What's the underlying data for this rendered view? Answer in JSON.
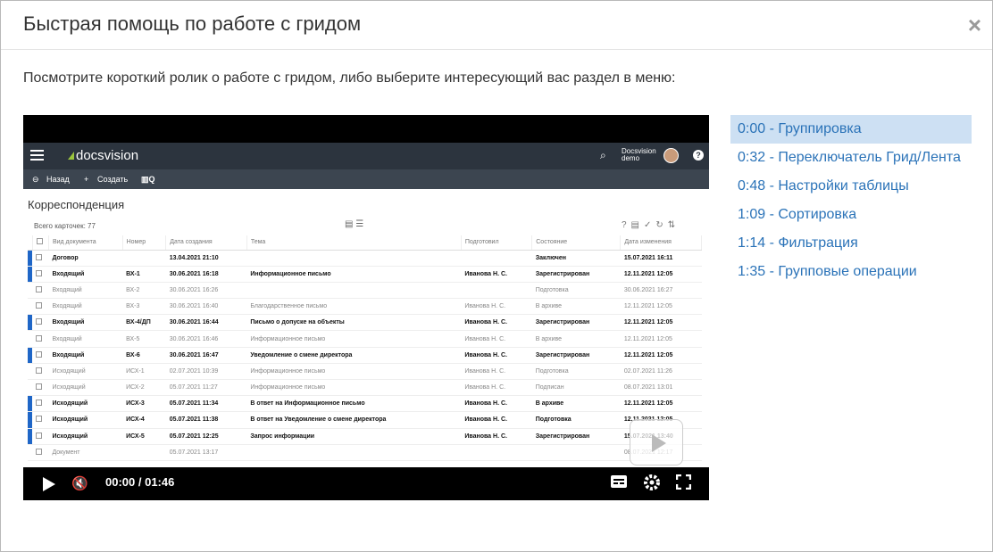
{
  "modal": {
    "title": "Быстрая помощь по работе с гридом",
    "close_label": "×",
    "intro": "Посмотрите короткий ролик о работе с гридом, либо выберите интересующий вас раздел в меню:"
  },
  "video": {
    "time": "00:00 / 01:46",
    "frame": {
      "brand": "docsvision",
      "user_line1": "Docsvision",
      "user_line2": "demo",
      "toolbar": {
        "back": "Назад",
        "create": "Создать"
      },
      "page_title": "Корреспонденция",
      "grid_info": "Всего карточек: 77",
      "columns": [
        "Вид документа",
        "Номер",
        "Дата создания",
        "Тема",
        "Подготовил",
        "Состояние",
        "Дата изменения"
      ],
      "rows": [
        [
          "Договор",
          "",
          "13.04.2021 21:10",
          "",
          "",
          "Заключен",
          "15.07.2021 16:11"
        ],
        [
          "Входящий",
          "ВХ-1",
          "30.06.2021 16:18",
          "Информационное письмо",
          "Иванова Н. С.",
          "Зарегистрирован",
          "12.11.2021 12:05"
        ],
        [
          "Входящий",
          "ВХ-2",
          "30.06.2021 16:26",
          "",
          "",
          "Подготовка",
          "30.06.2021 16:27"
        ],
        [
          "Входящий",
          "ВХ-3",
          "30.06.2021 16:40",
          "Благодарственное письмо",
          "Иванова Н. С.",
          "В архиве",
          "12.11.2021 12:05"
        ],
        [
          "Входящий",
          "ВХ-4/ДП",
          "30.06.2021 16:44",
          "Письмо о допуске на объекты",
          "Иванова Н. С.",
          "Зарегистрирован",
          "12.11.2021 12:05"
        ],
        [
          "Входящий",
          "ВХ-5",
          "30.06.2021 16:46",
          "Информационное письмо",
          "Иванова Н. С.",
          "В архиве",
          "12.11.2021 12:05"
        ],
        [
          "Входящий",
          "ВХ-6",
          "30.06.2021 16:47",
          "Уведомление о смене директора",
          "Иванова Н. С.",
          "Зарегистрирован",
          "12.11.2021 12:05"
        ],
        [
          "Исходящий",
          "ИСХ-1",
          "02.07.2021 10:39",
          "Информационное письмо",
          "Иванова Н. С.",
          "Подготовка",
          "02.07.2021 11:26"
        ],
        [
          "Исходящий",
          "ИСХ-2",
          "05.07.2021 11:27",
          "Информационное письмо",
          "Иванова Н. С.",
          "Подписан",
          "08.07.2021 13:01"
        ],
        [
          "Исходящий",
          "ИСХ-3",
          "05.07.2021 11:34",
          "В ответ на Информационное письмо",
          "Иванова Н. С.",
          "В архиве",
          "12.11.2021 12:05"
        ],
        [
          "Исходящий",
          "ИСХ-4",
          "05.07.2021 11:38",
          "В ответ на Уведомление о смене директора",
          "Иванова Н. С.",
          "Подготовка",
          "12.11.2021 12:05"
        ],
        [
          "Исходящий",
          "ИСХ-5",
          "05.07.2021 12:25",
          "Запрос информации",
          "Иванова Н. С.",
          "Зарегистрирован",
          "15.07.2021 13:40"
        ],
        [
          "Документ",
          "",
          "05.07.2021 13:17",
          "",
          "",
          "",
          "08.07.2021 12:17"
        ]
      ],
      "row_styles": [
        "unread",
        "unread",
        "read",
        "read",
        "unread",
        "read",
        "unread",
        "read",
        "read",
        "unread",
        "unread",
        "unread",
        "read"
      ]
    }
  },
  "chapters": [
    {
      "label": "0:00 - Группировка",
      "active": true
    },
    {
      "label": "0:32 - Переключатель Грид/Лента",
      "active": false
    },
    {
      "label": "0:48 - Настройки таблицы",
      "active": false
    },
    {
      "label": "1:09 - Сортировка",
      "active": false
    },
    {
      "label": "1:14 - Фильтрация",
      "active": false
    },
    {
      "label": "1:35 - Групповые операции",
      "active": false
    }
  ],
  "colors": {
    "link": "#2b73b8",
    "active_bg": "#cde0f3",
    "unread_marker": "#1f66c7"
  }
}
